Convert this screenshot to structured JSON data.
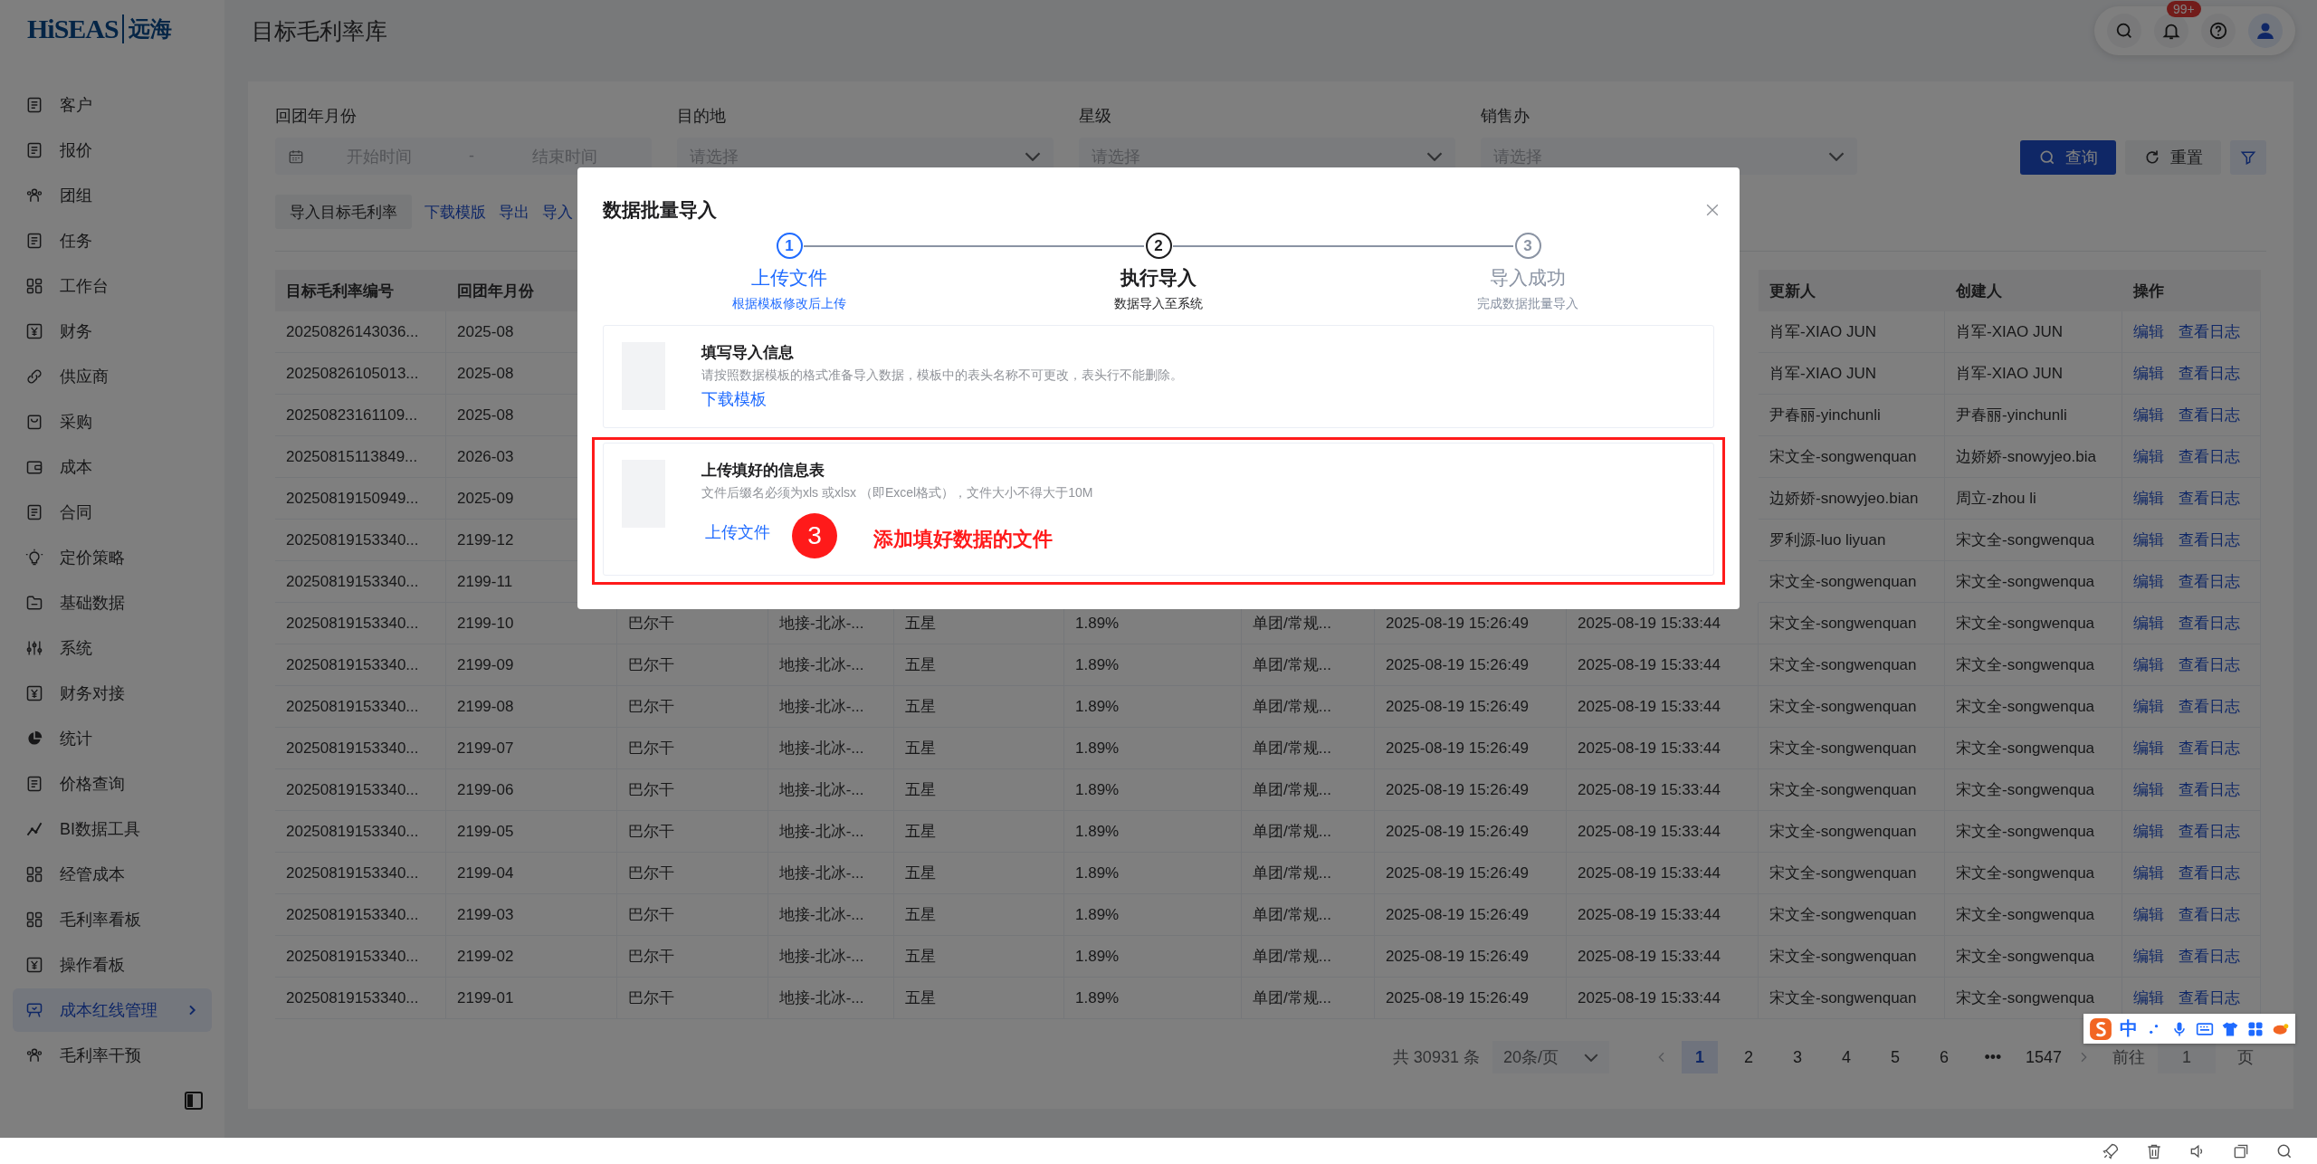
{
  "logo": {
    "latin": "HiSEAS",
    "chinese": "远海"
  },
  "sidebar": {
    "items": [
      {
        "label": "客户",
        "selected": false
      },
      {
        "label": "报价",
        "selected": false
      },
      {
        "label": "团组",
        "selected": false
      },
      {
        "label": "任务",
        "selected": false
      },
      {
        "label": "工作台",
        "selected": false
      },
      {
        "label": "财务",
        "selected": false
      },
      {
        "label": "供应商",
        "selected": false
      },
      {
        "label": "采购",
        "selected": false
      },
      {
        "label": "成本",
        "selected": false
      },
      {
        "label": "合同",
        "selected": false
      },
      {
        "label": "定价策略",
        "selected": false
      },
      {
        "label": "基础数据",
        "selected": false
      },
      {
        "label": "系统",
        "selected": false
      },
      {
        "label": "财务对接",
        "selected": false
      },
      {
        "label": "统计",
        "selected": false
      },
      {
        "label": "价格查询",
        "selected": false
      },
      {
        "label": "BI数据工具",
        "selected": false
      },
      {
        "label": "经管成本",
        "selected": false
      },
      {
        "label": "毛利率看板",
        "selected": false
      },
      {
        "label": "操作看板",
        "selected": false
      },
      {
        "label": "成本红线管理",
        "selected": true
      },
      {
        "label": "毛利率干预",
        "selected": false
      }
    ]
  },
  "header": {
    "title": "目标毛利率库",
    "notification_badge": "99+"
  },
  "filters": [
    {
      "kind": "daterange",
      "label": "回团年月份",
      "start_placeholder": "开始时间",
      "separator": "-",
      "end_placeholder": "结束时间"
    },
    {
      "kind": "select",
      "label": "目的地",
      "placeholder": "请选择"
    },
    {
      "kind": "select",
      "label": "星级",
      "placeholder": "请选择"
    },
    {
      "kind": "select",
      "label": "销售办",
      "placeholder": "请选择"
    }
  ],
  "filter_buttons": [
    {
      "kind": "primary",
      "label": "查询"
    },
    {
      "kind": "default",
      "label": "重置"
    },
    {
      "kind": "icon"
    }
  ],
  "toolbar": {
    "button": "导入目标毛利率",
    "links": [
      "下载模版",
      "导出",
      "导入"
    ]
  },
  "table": {
    "columns_left": [
      "目标毛利率编号",
      "回团年月份"
    ],
    "columns_right": [
      "更新人",
      "创建人",
      "操作"
    ],
    "rows": [
      {
        "number": "20250826143036...",
        "month": "2025-08",
        "updated_by": "肖军-XIAO JUN",
        "created_by": "肖军-XIAO JUN",
        "actions": [
          "编辑",
          "查看日志"
        ]
      },
      {
        "number": "20250826105013...",
        "month": "2025-08",
        "updated_by": "肖军-XIAO JUN",
        "created_by": "肖军-XIAO JUN",
        "actions": [
          "编辑",
          "查看日志"
        ]
      },
      {
        "number": "20250823161109...",
        "month": "2025-08",
        "updated_by": "尹春丽-yinchunli",
        "created_by": "尹春丽-yinchunli",
        "actions": [
          "编辑",
          "查看日志"
        ]
      },
      {
        "number": "20250815113849...",
        "month": "2026-03",
        "updated_by": "宋文全-songwenquan",
        "created_by": "边娇娇-snowyjeo.bia",
        "actions": [
          "编辑",
          "查看日志"
        ]
      },
      {
        "number": "20250819150949...",
        "month": "2025-09",
        "updated_by": "边娇娇-snowyjeo.bian",
        "created_by": "周立-zhou li",
        "actions": [
          "编辑",
          "查看日志"
        ]
      },
      {
        "number": "20250819153340...",
        "month": "2199-12",
        "updated_by": "罗利源-luo liyuan",
        "created_by": "宋文全-songwenqua",
        "actions": [
          "编辑",
          "查看日志"
        ]
      },
      {
        "number": "20250819153340...",
        "month": "2199-11",
        "updated_by": "宋文全-songwenquan",
        "created_by": "宋文全-songwenqua",
        "actions": [
          "编辑",
          "查看日志"
        ]
      },
      {
        "number": "20250819153340...",
        "month": "2199-10",
        "middle": [
          "巴尔干",
          "地接-北冰-...",
          "五星",
          "1.89%",
          "单团/常规...",
          "2025-08-19 15:26:49",
          "2025-08-19 15:33:44"
        ],
        "updated_by": "宋文全-songwenquan",
        "created_by": "宋文全-songwenqua",
        "actions": [
          "编辑",
          "查看日志"
        ]
      },
      {
        "number": "20250819153340...",
        "month": "2199-09",
        "middle": [
          "巴尔干",
          "地接-北冰-...",
          "五星",
          "1.89%",
          "单团/常规...",
          "2025-08-19 15:26:49",
          "2025-08-19 15:33:44"
        ],
        "updated_by": "宋文全-songwenquan",
        "created_by": "宋文全-songwenqua",
        "actions": [
          "编辑",
          "查看日志"
        ]
      },
      {
        "number": "20250819153340...",
        "month": "2199-08",
        "middle": [
          "巴尔干",
          "地接-北冰-...",
          "五星",
          "1.89%",
          "单团/常规...",
          "2025-08-19 15:26:49",
          "2025-08-19 15:33:44"
        ],
        "updated_by": "宋文全-songwenquan",
        "created_by": "宋文全-songwenqua",
        "actions": [
          "编辑",
          "查看日志"
        ]
      },
      {
        "number": "20250819153340...",
        "month": "2199-07",
        "middle": [
          "巴尔干",
          "地接-北冰-...",
          "五星",
          "1.89%",
          "单团/常规...",
          "2025-08-19 15:26:49",
          "2025-08-19 15:33:44"
        ],
        "updated_by": "宋文全-songwenquan",
        "created_by": "宋文全-songwenqua",
        "actions": [
          "编辑",
          "查看日志"
        ]
      },
      {
        "number": "20250819153340...",
        "month": "2199-06",
        "middle": [
          "巴尔干",
          "地接-北冰-...",
          "五星",
          "1.89%",
          "单团/常规...",
          "2025-08-19 15:26:49",
          "2025-08-19 15:33:44"
        ],
        "updated_by": "宋文全-songwenquan",
        "created_by": "宋文全-songwenqua",
        "actions": [
          "编辑",
          "查看日志"
        ]
      },
      {
        "number": "20250819153340...",
        "month": "2199-05",
        "middle": [
          "巴尔干",
          "地接-北冰-...",
          "五星",
          "1.89%",
          "单团/常规...",
          "2025-08-19 15:26:49",
          "2025-08-19 15:33:44"
        ],
        "updated_by": "宋文全-songwenquan",
        "created_by": "宋文全-songwenqua",
        "actions": [
          "编辑",
          "查看日志"
        ]
      },
      {
        "number": "20250819153340...",
        "month": "2199-04",
        "middle": [
          "巴尔干",
          "地接-北冰-...",
          "五星",
          "1.89%",
          "单团/常规...",
          "2025-08-19 15:26:49",
          "2025-08-19 15:33:44"
        ],
        "updated_by": "宋文全-songwenquan",
        "created_by": "宋文全-songwenqua",
        "actions": [
          "编辑",
          "查看日志"
        ]
      },
      {
        "number": "20250819153340...",
        "month": "2199-03",
        "middle": [
          "巴尔干",
          "地接-北冰-...",
          "五星",
          "1.89%",
          "单团/常规...",
          "2025-08-19 15:26:49",
          "2025-08-19 15:33:44"
        ],
        "updated_by": "宋文全-songwenquan",
        "created_by": "宋文全-songwenqua",
        "actions": [
          "编辑",
          "查看日志"
        ]
      },
      {
        "number": "20250819153340...",
        "month": "2199-02",
        "middle": [
          "巴尔干",
          "地接-北冰-...",
          "五星",
          "1.89%",
          "单团/常规...",
          "2025-08-19 15:26:49",
          "2025-08-19 15:33:44"
        ],
        "updated_by": "宋文全-songwenquan",
        "created_by": "宋文全-songwenqua",
        "actions": [
          "编辑",
          "查看日志"
        ]
      },
      {
        "number": "20250819153340...",
        "month": "2199-01",
        "middle": [
          "巴尔干",
          "地接-北冰-...",
          "五星",
          "1.89%",
          "单团/常规...",
          "2025-08-19 15:26:49",
          "2025-08-19 15:33:44"
        ],
        "updated_by": "宋文全-songwenquan",
        "created_by": "宋文全-songwenqua",
        "actions": [
          "编辑",
          "查看日志"
        ]
      }
    ]
  },
  "pagination": {
    "total": "共 30931 条",
    "page_size": "20条/页",
    "pages": [
      {
        "label": "1",
        "selected": true
      },
      {
        "label": "2",
        "selected": false
      },
      {
        "label": "3",
        "selected": false
      },
      {
        "label": "4",
        "selected": false
      },
      {
        "label": "5",
        "selected": false
      },
      {
        "label": "6",
        "selected": false
      },
      {
        "label": "•••",
        "selected": false
      },
      {
        "label": "1547",
        "selected": false
      }
    ],
    "goto_label": "前往",
    "goto_value": "1",
    "goto_suffix": "页"
  },
  "modal": {
    "title": "数据批量导入",
    "steps": [
      {
        "number": "1",
        "title": "上传文件",
        "description": "根据模板修改后上传",
        "done": true,
        "current": false
      },
      {
        "number": "2",
        "title": "执行导入",
        "description": "数据导入至系统",
        "done": false,
        "current": true
      },
      {
        "number": "3",
        "title": "导入成功",
        "description": "完成数据批量导入",
        "done": false,
        "current": false
      }
    ],
    "cards": [
      {
        "title": "填写导入信息",
        "description": "请按照数据模板的格式准备导入数据，模板中的表头名称不可更改，表头行不能删除。",
        "link": "下载模板",
        "highlighted": false
      },
      {
        "title": "上传填好的信息表",
        "description": "文件后缀名必须为xls 或xlsx （即Excel格式），文件大小不得大于10M",
        "link": "上传文件",
        "highlighted": true
      }
    ],
    "annotation": {
      "badge": "3",
      "text": "添加填好数据的文件"
    }
  },
  "ime_toolbar": {
    "mode": "中"
  }
}
